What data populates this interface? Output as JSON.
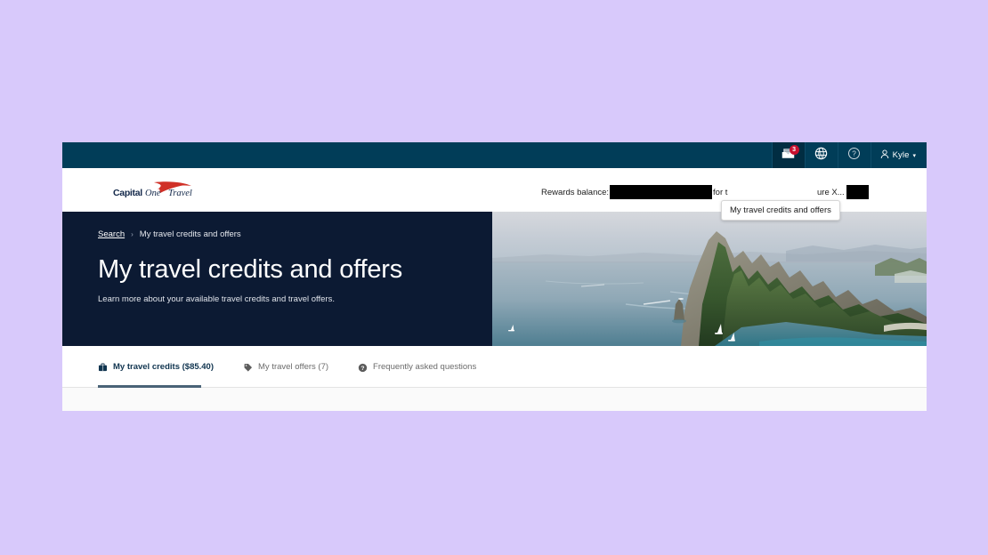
{
  "page": {
    "background_color": "#d8c9fb",
    "brand_navy": "#10344f",
    "hero_navy": "#0c1a33",
    "topbar_color": "#013d58",
    "badge_color": "#c8102e",
    "accent_underline": "#4a6377"
  },
  "topbar": {
    "items": [
      {
        "name": "travel-credits-offers",
        "icon": "inbox-icon",
        "badge": "3"
      },
      {
        "name": "language",
        "icon": "globe-icon",
        "badge": ""
      },
      {
        "name": "help",
        "icon": "help-circle-icon",
        "badge": ""
      }
    ],
    "user": {
      "icon": "user-icon",
      "label": "Kyle",
      "caret": "▾"
    }
  },
  "tooltip": {
    "text": "My travel credits and offers"
  },
  "brand": {
    "logo_capital": "Capital",
    "logo_one": "One",
    "logo_travel": "Travel"
  },
  "rewards": {
    "label": "Rewards balance:",
    "value_redacted": true,
    "middle_text": "for t",
    "tail_text": "ure X...",
    "tail_redacted": true
  },
  "hero": {
    "breadcrumb": {
      "root": "Search",
      "separator": "›",
      "current": "My travel credits and offers"
    },
    "title": "My travel credits and offers",
    "subtitle": "Learn more about your available travel credits and travel offers.",
    "image_alt": "tropical island coastline with limestone cliffs and boats"
  },
  "tabs": [
    {
      "label": "My travel credits ($85.40)",
      "icon": "suitcase-icon",
      "selected": true
    },
    {
      "label": "My travel offers (7)",
      "icon": "tag-icon",
      "selected": false
    },
    {
      "label": "Frequently asked questions",
      "icon": "question-circle-icon",
      "selected": false
    }
  ]
}
